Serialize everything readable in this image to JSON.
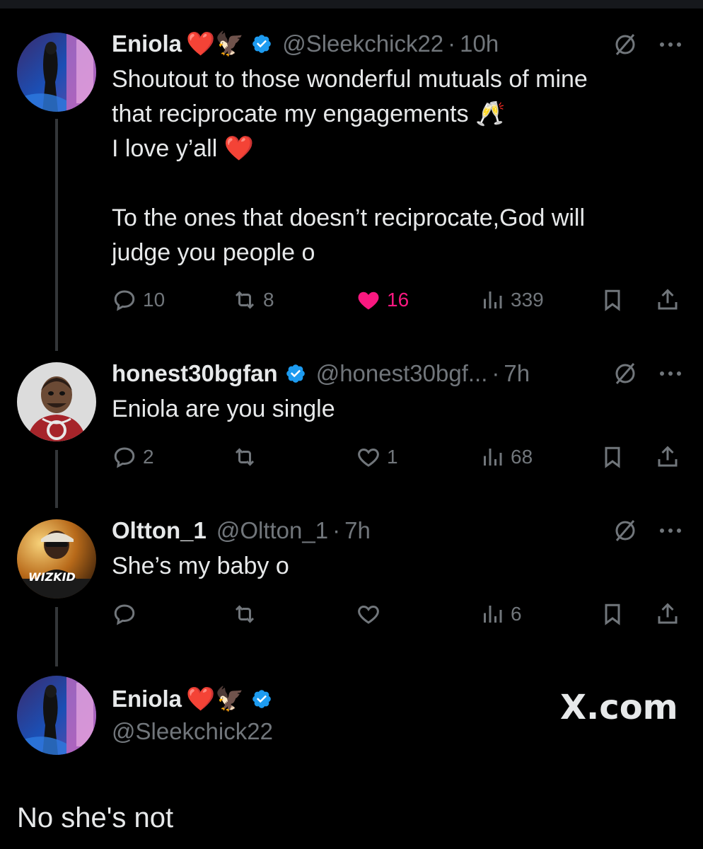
{
  "posts": [
    {
      "name": "Eniola",
      "emojis": "❤️🦅",
      "handle": "@Sleekchick22",
      "time": "10h",
      "lines": [
        "Shoutout to those wonderful mutuals of mine",
        "that reciprocate my engagements 🥂",
        "I love y’all ❤️",
        "",
        "To the ones that doesn’t reciprocate,God will",
        "judge you people o"
      ],
      "replies": "10",
      "reposts": "8",
      "likes": "16",
      "views": "339"
    },
    {
      "name": "honest30bgfan",
      "handle": "@honest30bgf...",
      "time": "7h",
      "lines": [
        "Eniola are you single"
      ],
      "replies": "2",
      "reposts": "",
      "likes": "1",
      "views": "68"
    },
    {
      "name": "Oltton_1",
      "handle": "@Oltton_1",
      "time": "7h",
      "lines": [
        "She’s my baby o"
      ],
      "replies": "",
      "reposts": "",
      "likes": "",
      "views": "6",
      "avatar_text": "WIZKID"
    }
  ],
  "quote": {
    "name": "Eniola",
    "emojis": "❤️🦅",
    "handle": "@Sleekchick22"
  },
  "brand": "X.com",
  "caption": "No she's not",
  "colors": {
    "background": "#000000",
    "text": "#e7e9ea",
    "muted": "#71767b",
    "like": "#f91880",
    "verified": "#1d9bf0"
  },
  "icons": [
    "reply-icon",
    "repost-icon",
    "like-icon",
    "views-icon",
    "bookmark-icon",
    "share-icon",
    "grok-icon",
    "more-icon",
    "verified-icon"
  ]
}
